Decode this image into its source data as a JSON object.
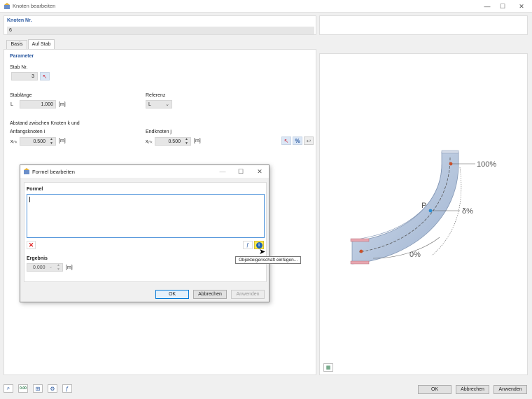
{
  "window": {
    "title": "Knoten bearbeiten"
  },
  "node": {
    "label": "Knoten Nr.",
    "value": "6"
  },
  "tabs": [
    {
      "label": "Basis"
    },
    {
      "label": "Auf Stab"
    }
  ],
  "params": {
    "section": "Parameter",
    "stab_label": "Stab Nr.",
    "stab_value": "3",
    "length_label": "Stablänge",
    "length_symbol": "L",
    "length_value": "1.000",
    "length_unit": "[m]",
    "ref_label": "Referenz",
    "ref_value": "L",
    "dist_label_line1": "Abstand zwischen Knoten k und",
    "dist_label_line2": "Anfangsknoten i",
    "xik_symbol": "xᵢ-ₖ",
    "xik_value": "0.500",
    "xik_unit": "[m]",
    "end_label": "Endknoten j",
    "xjk_symbol": "xⱼ-ₖ",
    "xjk_value": "0.500",
    "xjk_unit": "[m]"
  },
  "diagram": {
    "label_100": "100%",
    "label_p": "P",
    "label_delta": "δ%",
    "label_0": "0%"
  },
  "dialog": {
    "title": "Formel bearbeiten",
    "formel_label": "Formel",
    "formula_text": "",
    "ergebnis_label": "Ergebnis",
    "ergebnis_value": "0.000",
    "ergebnis_unit": "[m]",
    "ok": "OK",
    "cancel": "Abbrechen",
    "apply": "Anwenden"
  },
  "tooltip": {
    "text": "Objekteigenschaft einfügen..."
  },
  "footer": {
    "ok": "OK",
    "cancel": "Abbrechen",
    "apply": "Anwenden",
    "units_badge": "0.00"
  },
  "colors": {
    "accent": "#2c5aa0",
    "beam": "#b9c9e0",
    "flange": "#e8a6b0"
  }
}
